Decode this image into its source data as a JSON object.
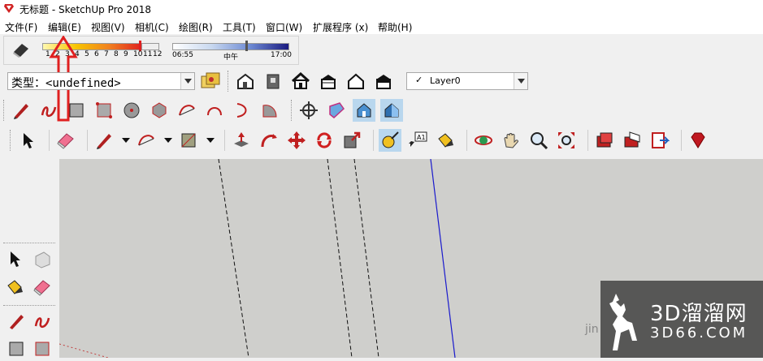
{
  "window": {
    "title": "无标题 - SketchUp Pro 2018"
  },
  "menu": [
    "文件(F)",
    "编辑(E)",
    "视图(V)",
    "相机(C)",
    "绘图(R)",
    "工具(T)",
    "窗口(W)",
    "扩展程序 (x)",
    "帮助(H)"
  ],
  "shadows": {
    "month_ticks": [
      "1",
      "2",
      "3",
      "4",
      "5",
      "6",
      "7",
      "8",
      "9",
      "10",
      "11",
      "12"
    ],
    "time_start": "06:55",
    "time_mid": "中午",
    "time_end": "17:00"
  },
  "type_combo": {
    "label": "类型：",
    "value": "<undefined>"
  },
  "layer_combo": {
    "value": "Layer0"
  },
  "watermark": {
    "brand": "3D溜溜网",
    "url": "3D66.COM",
    "overlay_text": "jin"
  },
  "colors": {
    "accent_red": "#e02020",
    "selected_tool": "#b9d7ee",
    "canvas": "#cfcfcc",
    "axis_blue": "#1a1acc"
  }
}
